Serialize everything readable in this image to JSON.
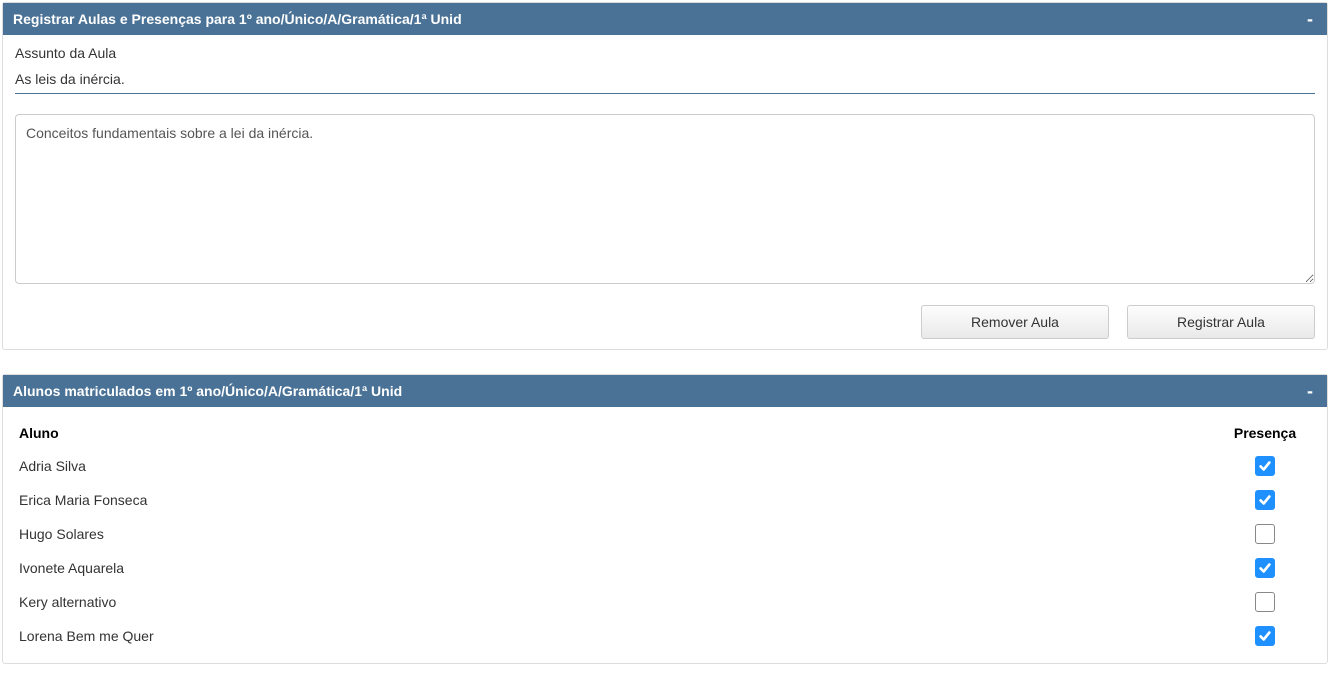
{
  "panel1": {
    "title": "Registrar Aulas e Presenças para 1º ano/Único/A/Gramática/1ª Unid",
    "collapse_symbol": "-",
    "subject_label": "Assunto da Aula",
    "subject_value": "As leis da inércia.",
    "description_value": "Conceitos fundamentais sobre a lei da inércia.",
    "remove_button": "Remover Aula",
    "register_button": "Registrar Aula"
  },
  "panel2": {
    "title": "Alunos matriculados em 1º ano/Único/A/Gramática/1ª Unid",
    "collapse_symbol": "-",
    "col_aluno": "Aluno",
    "col_presenca": "Presença"
  },
  "students": [
    {
      "name": "Adria Silva",
      "present": true
    },
    {
      "name": "Erica Maria Fonseca",
      "present": true
    },
    {
      "name": "Hugo Solares",
      "present": false
    },
    {
      "name": "Ivonete Aquarela",
      "present": true
    },
    {
      "name": "Kery alternativo",
      "present": false
    },
    {
      "name": "Lorena Bem me Quer",
      "present": true
    }
  ]
}
